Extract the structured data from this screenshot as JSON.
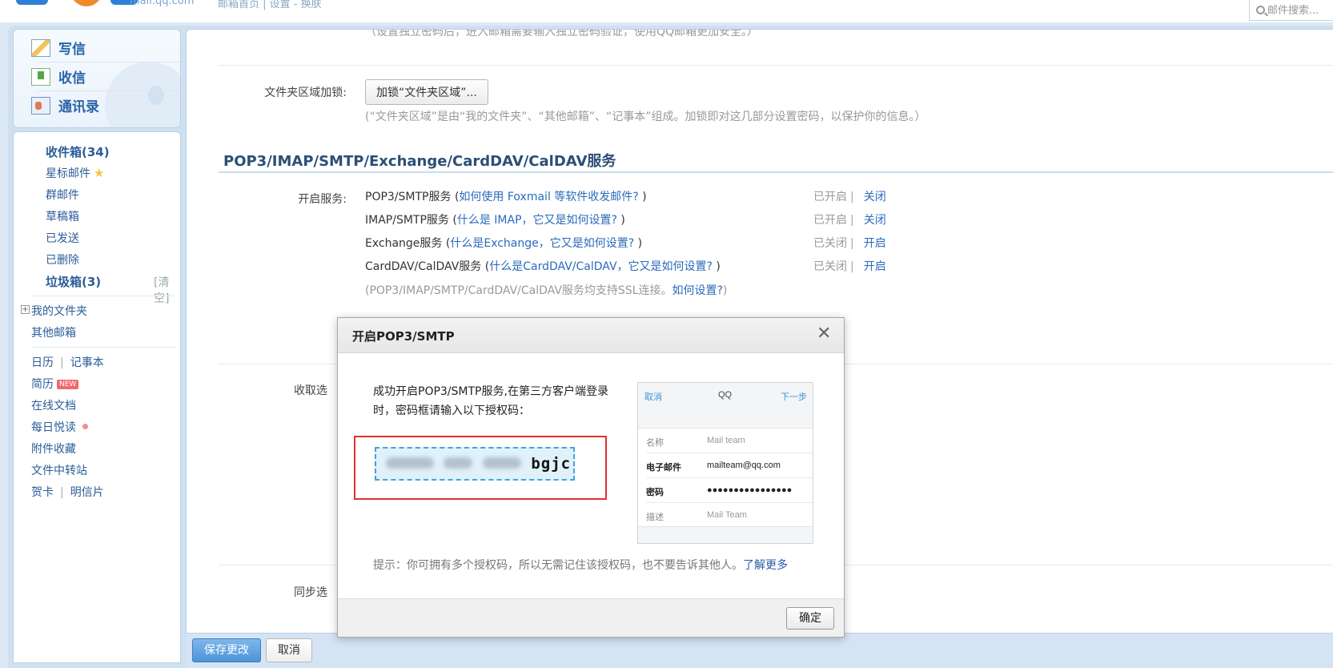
{
  "header": {
    "logo_domain": "mail.qq.com",
    "top_links": "邮箱首页 | 设置 - 换肤",
    "search_placeholder": "邮件搜索..."
  },
  "sidebar": {
    "primary": [
      {
        "label": "写信",
        "icon": "write-icon"
      },
      {
        "label": "收信",
        "icon": "inbox-download-icon"
      },
      {
        "label": "通讯录",
        "icon": "contacts-icon"
      }
    ],
    "inbox": "收件箱(34)",
    "starred": "星标邮件",
    "group": "群邮件",
    "drafts": "草稿箱",
    "sent": "已发送",
    "deleted": "已删除",
    "spam": "垃圾箱(3)",
    "spam_clear": "[清空]",
    "my_folders": "我的文件夹",
    "other_mail": "其他邮箱",
    "calendar": "日历",
    "notes": "记事本",
    "resume": "简历",
    "resume_badge": "NEW",
    "docs": "在线文档",
    "daily": "每日悦读",
    "attachments": "附件收藏",
    "transfer": "文件中转站",
    "cards": "贺卡",
    "postcards": "明信片"
  },
  "main": {
    "top_note": "（设置独立密码后，进入邮箱需要输入独立密码验证，使用QQ邮箱更加安全。）",
    "folder_lock_label": "文件夹区域加锁:",
    "folder_lock_button": "加锁“文件夹区域”...",
    "folder_lock_note": "(“文件夹区域”是由“我的文件夹”、“其他邮箱”、“记事本”组成。加锁即对这几部分设置密码，以保护你的信息。）",
    "section_title": "POP3/IMAP/SMTP/Exchange/CardDAV/CalDAV服务",
    "services_label": "开启服务:",
    "services": [
      {
        "name": "POP3/SMTP服务",
        "help": "如何使用 Foxmail 等软件收发邮件?",
        "state": "已开启",
        "action": "关闭"
      },
      {
        "name": "IMAP/SMTP服务",
        "help": "什么是 IMAP，它又是如何设置?",
        "state": "已开启",
        "action": "关闭"
      },
      {
        "name": "Exchange服务",
        "help": "什么是Exchange，它又是如何设置?",
        "state": "已关闭",
        "action": "开启"
      },
      {
        "name": "CardDAV/CalDAV服务",
        "help": "什么是CardDAV/CalDAV，它又是如何设置?",
        "state": "已关闭",
        "action": "开启"
      }
    ],
    "ssl_note": "(POP3/IMAP/SMTP/CardDAV/CalDAV服务均支持SSL连接。",
    "ssl_link": "如何设置?",
    "ssl_close": ")",
    "receive_label": "收取选",
    "sync_label": "同步选",
    "save_button": "保存更改",
    "cancel_button": "取消"
  },
  "modal": {
    "title": "开启POP3/SMTP",
    "description": "成功开启POP3/SMTP服务,在第三方客户端登录时，密码框请输入以下授权码：",
    "code_visible": "bgjc",
    "phone": {
      "cancel": "取消",
      "title": "QQ",
      "next": "下一步",
      "rows": [
        {
          "key": "名称",
          "value": "Mail team"
        },
        {
          "key": "电子邮件",
          "value": "mailteam@qq.com"
        },
        {
          "key": "密码",
          "value": "●●●●●●●●●●●●●●●●"
        },
        {
          "key": "描述",
          "value": "Mail Team"
        }
      ]
    },
    "tip": "提示：你可拥有多个授权码，所以无需记住该授权码，也不要告诉其他人。",
    "tip_link": "了解更多",
    "ok_button": "确定"
  }
}
